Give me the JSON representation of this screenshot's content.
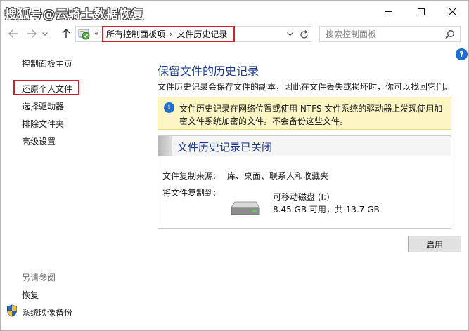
{
  "window": {
    "watermark": "搜狐号@云骑士数据恢复"
  },
  "address": {
    "overflow_chevron": "«",
    "crumbs": [
      "所有控制面板项",
      "文件历史记录"
    ],
    "separator": "›"
  },
  "search": {
    "placeholder": "搜索控制面板"
  },
  "sidebar": {
    "home": "控制面板主页",
    "items": [
      "还原个人文件",
      "选择驱动器",
      "排除文件夹",
      "高级设置"
    ],
    "see_also_label": "另请参阅",
    "see_also": [
      "恢复",
      "系统映像备份"
    ]
  },
  "main": {
    "title": "保留文件的历史记录",
    "description": "文件历史记录会保存文件的副本，因此在文件丢失或损坏时，你可以找回它们。",
    "info": "文件历史记录在网络位置或使用 NTFS 文件系统的驱动器上发现使用加密文件系统加密的文件。不会备份这些文件。",
    "status_title": "文件历史记录已关闭",
    "copy_from_label": "文件复制来源:",
    "copy_from_value": "库、桌面、联系人和收藏夹",
    "copy_to_label": "将文件复制到:",
    "drive_name": "可移动磁盘 (I:)",
    "drive_space": "8.45 GB 可用，共 13.7 GB",
    "enable_button": "启用"
  },
  "colors": {
    "accent_title": "#1e3c8c",
    "highlight_border": "#d21f2a",
    "info_background": "#fdf5c4",
    "help_blue": "#1f6fd1"
  }
}
